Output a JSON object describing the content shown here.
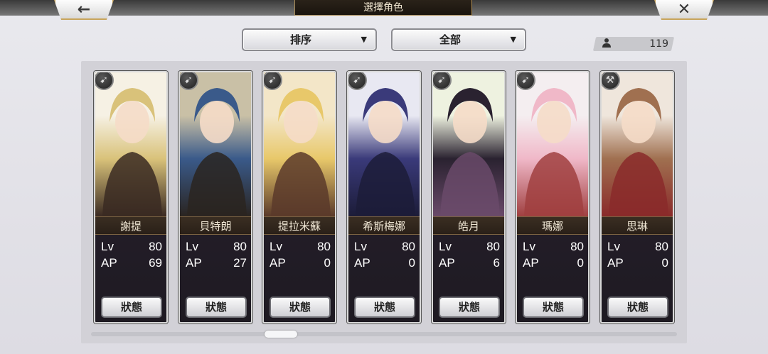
{
  "header": {
    "title": "選擇角色",
    "back_icon": "←",
    "close_icon": "✕"
  },
  "toolbar": {
    "sort_label": "排序",
    "filter_label": "全部",
    "dropdown_arrow": "▼",
    "count_icon": "👤",
    "count": "119"
  },
  "stat_labels": {
    "lv": "Lv",
    "ap": "AP"
  },
  "characters": [
    {
      "name": "謝提",
      "lv": "80",
      "ap": "69",
      "status": "狀態",
      "class_icon": "➹",
      "colors": [
        "#f6f1e4",
        "#d9c27a",
        "#3a2a22"
      ]
    },
    {
      "name": "貝特朗",
      "lv": "80",
      "ap": "27",
      "status": "狀態",
      "class_icon": "➹",
      "colors": [
        "#c9c0a6",
        "#3a5a8a",
        "#2a2420"
      ]
    },
    {
      "name": "提拉米蘇",
      "lv": "80",
      "ap": "0",
      "status": "狀態",
      "class_icon": "➹",
      "colors": [
        "#f3e6c8",
        "#e8c86a",
        "#5a3a2a"
      ]
    },
    {
      "name": "希斯梅娜",
      "lv": "80",
      "ap": "0",
      "status": "狀態",
      "class_icon": "➹",
      "colors": [
        "#e8e8f2",
        "#3a3a7a",
        "#1c1c38"
      ]
    },
    {
      "name": "皓月",
      "lv": "80",
      "ap": "6",
      "status": "狀態",
      "class_icon": "➹",
      "colors": [
        "#eef2e0",
        "#2a2230",
        "#6a4a6a"
      ]
    },
    {
      "name": "瑪娜",
      "lv": "80",
      "ap": "0",
      "status": "狀態",
      "class_icon": "➹",
      "colors": [
        "#f4eef0",
        "#f0b8c8",
        "#a04040"
      ]
    },
    {
      "name": "思琳",
      "lv": "80",
      "ap": "0",
      "status": "狀態",
      "class_icon": "⚒",
      "colors": [
        "#efe6dc",
        "#a07050",
        "#8a2a2a"
      ]
    }
  ]
}
